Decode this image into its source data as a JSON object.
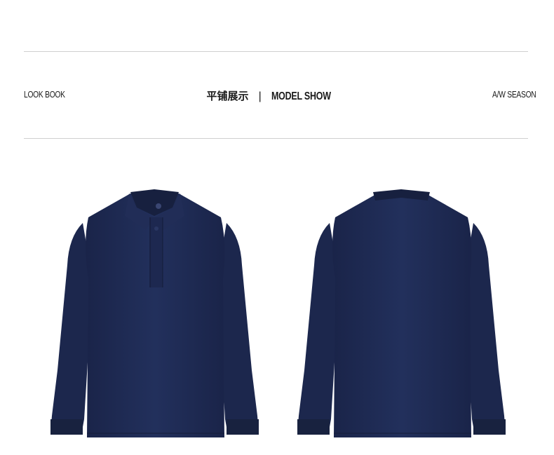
{
  "header": {
    "left_label": "LOOK BOOK",
    "title_cn": "平铺展示",
    "separator": "|",
    "title_en": "MODEL SHOW",
    "right_label": "A/W SEASON"
  },
  "colors": {
    "garment": "#1f2b54",
    "garment_shadow": "#17213f",
    "rule": "#cfcfcf"
  },
  "images": [
    {
      "name": "polo-front",
      "icon": "long-sleeve-polo-front"
    },
    {
      "name": "polo-back",
      "icon": "long-sleeve-polo-back"
    }
  ]
}
